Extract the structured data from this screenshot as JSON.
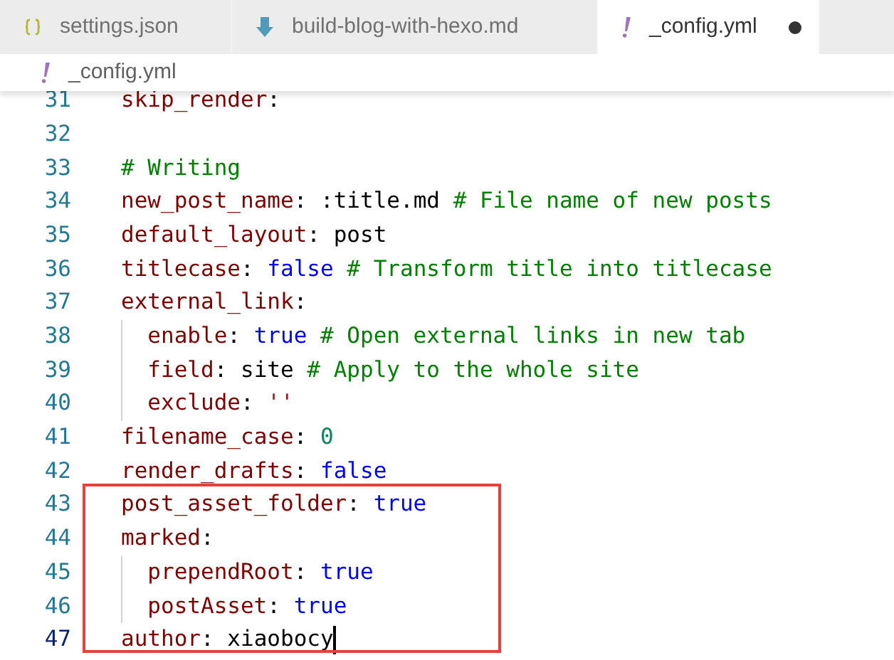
{
  "tabs": [
    {
      "label": "settings.json",
      "kind": "json",
      "selected": false,
      "dirty": false
    },
    {
      "label": "build-blog-with-hexo.md",
      "kind": "markdown",
      "selected": false,
      "dirty": false
    },
    {
      "label": "_config.yml",
      "kind": "yaml",
      "selected": true,
      "dirty": true
    }
  ],
  "breadcrumb": {
    "kind": "yaml",
    "label": "_config.yml"
  },
  "lines": [
    {
      "number": "31",
      "current": false,
      "boxed": false,
      "tokens": [
        {
          "kind": "key",
          "text": "skip_render"
        },
        {
          "kind": "plain",
          "text": ":"
        }
      ]
    },
    {
      "number": "32",
      "current": false,
      "boxed": false
    },
    {
      "number": "33",
      "current": false,
      "boxed": false,
      "tokens": [
        {
          "kind": "comment",
          "text": "# Writing"
        }
      ]
    },
    {
      "number": "34",
      "current": false,
      "boxed": false,
      "tokens": [
        {
          "kind": "key",
          "text": "new_post_name"
        },
        {
          "kind": "plain",
          "text": ": :title.md "
        },
        {
          "kind": "comment",
          "text": "# File name of new posts"
        }
      ]
    },
    {
      "number": "35",
      "current": false,
      "boxed": false,
      "tokens": [
        {
          "kind": "key",
          "text": "default_layout"
        },
        {
          "kind": "plain",
          "text": ": post"
        }
      ]
    },
    {
      "number": "36",
      "current": false,
      "boxed": false,
      "tokens": [
        {
          "kind": "key",
          "text": "titlecase"
        },
        {
          "kind": "plain",
          "text": ": "
        },
        {
          "kind": "bool",
          "text": "false"
        },
        {
          "kind": "comment",
          "text": " # Transform title into titlecase"
        }
      ]
    },
    {
      "number": "37",
      "current": false,
      "boxed": false,
      "tokens": [
        {
          "kind": "key",
          "text": "external_link"
        },
        {
          "kind": "plain",
          "text": ":"
        }
      ],
      "children": [
        {
          "number": "38",
          "current": false,
          "tokens": [
            {
              "kind": "key",
              "text": "enable"
            },
            {
              "kind": "plain",
              "text": ": "
            },
            {
              "kind": "bool",
              "text": "true"
            },
            {
              "kind": "comment",
              "text": " # Open external links in new tab"
            }
          ]
        },
        {
          "number": "39",
          "current": false,
          "tokens": [
            {
              "kind": "key",
              "text": "field"
            },
            {
              "kind": "plain",
              "text": ": site "
            },
            {
              "kind": "comment",
              "text": "# Apply to the whole site"
            }
          ]
        },
        {
          "number": "40",
          "current": false,
          "tokens": [
            {
              "kind": "key",
              "text": "exclude"
            },
            {
              "kind": "plain",
              "text": ": "
            },
            {
              "kind": "string",
              "text": "''"
            }
          ]
        }
      ]
    },
    {
      "number": "41",
      "current": false,
      "boxed": false,
      "tokens": [
        {
          "kind": "key",
          "text": "filename_case"
        },
        {
          "kind": "plain",
          "text": ": "
        },
        {
          "kind": "number",
          "text": "0"
        }
      ]
    },
    {
      "number": "42",
      "current": false,
      "boxed": false,
      "tokens": [
        {
          "kind": "key",
          "text": "render_drafts"
        },
        {
          "kind": "plain",
          "text": ": "
        },
        {
          "kind": "bool",
          "text": "false"
        }
      ]
    },
    {
      "number": "43",
      "current": false,
      "boxed": true,
      "tokens": [
        {
          "kind": "key",
          "text": "post_asset_folder"
        },
        {
          "kind": "plain",
          "text": ": "
        },
        {
          "kind": "bool",
          "text": "true"
        }
      ]
    },
    {
      "number": "44",
      "current": false,
      "boxed": true,
      "tokens": [
        {
          "kind": "key",
          "text": "marked"
        },
        {
          "kind": "plain",
          "text": ":"
        }
      ],
      "children": [
        {
          "number": "45",
          "current": false,
          "tokens": [
            {
              "kind": "key",
              "text": "prependRoot"
            },
            {
              "kind": "plain",
              "text": ": "
            },
            {
              "kind": "bool",
              "text": "true"
            }
          ]
        },
        {
          "number": "46",
          "current": false,
          "tokens": [
            {
              "kind": "key",
              "text": "postAsset"
            },
            {
              "kind": "plain",
              "text": ": "
            },
            {
              "kind": "bool",
              "text": "true"
            }
          ]
        }
      ]
    },
    {
      "number": "47",
      "current": true,
      "boxed": true,
      "tokens": [
        {
          "kind": "key",
          "text": "author"
        },
        {
          "kind": "plain",
          "text": ": xiaobocy"
        }
      ]
    }
  ]
}
